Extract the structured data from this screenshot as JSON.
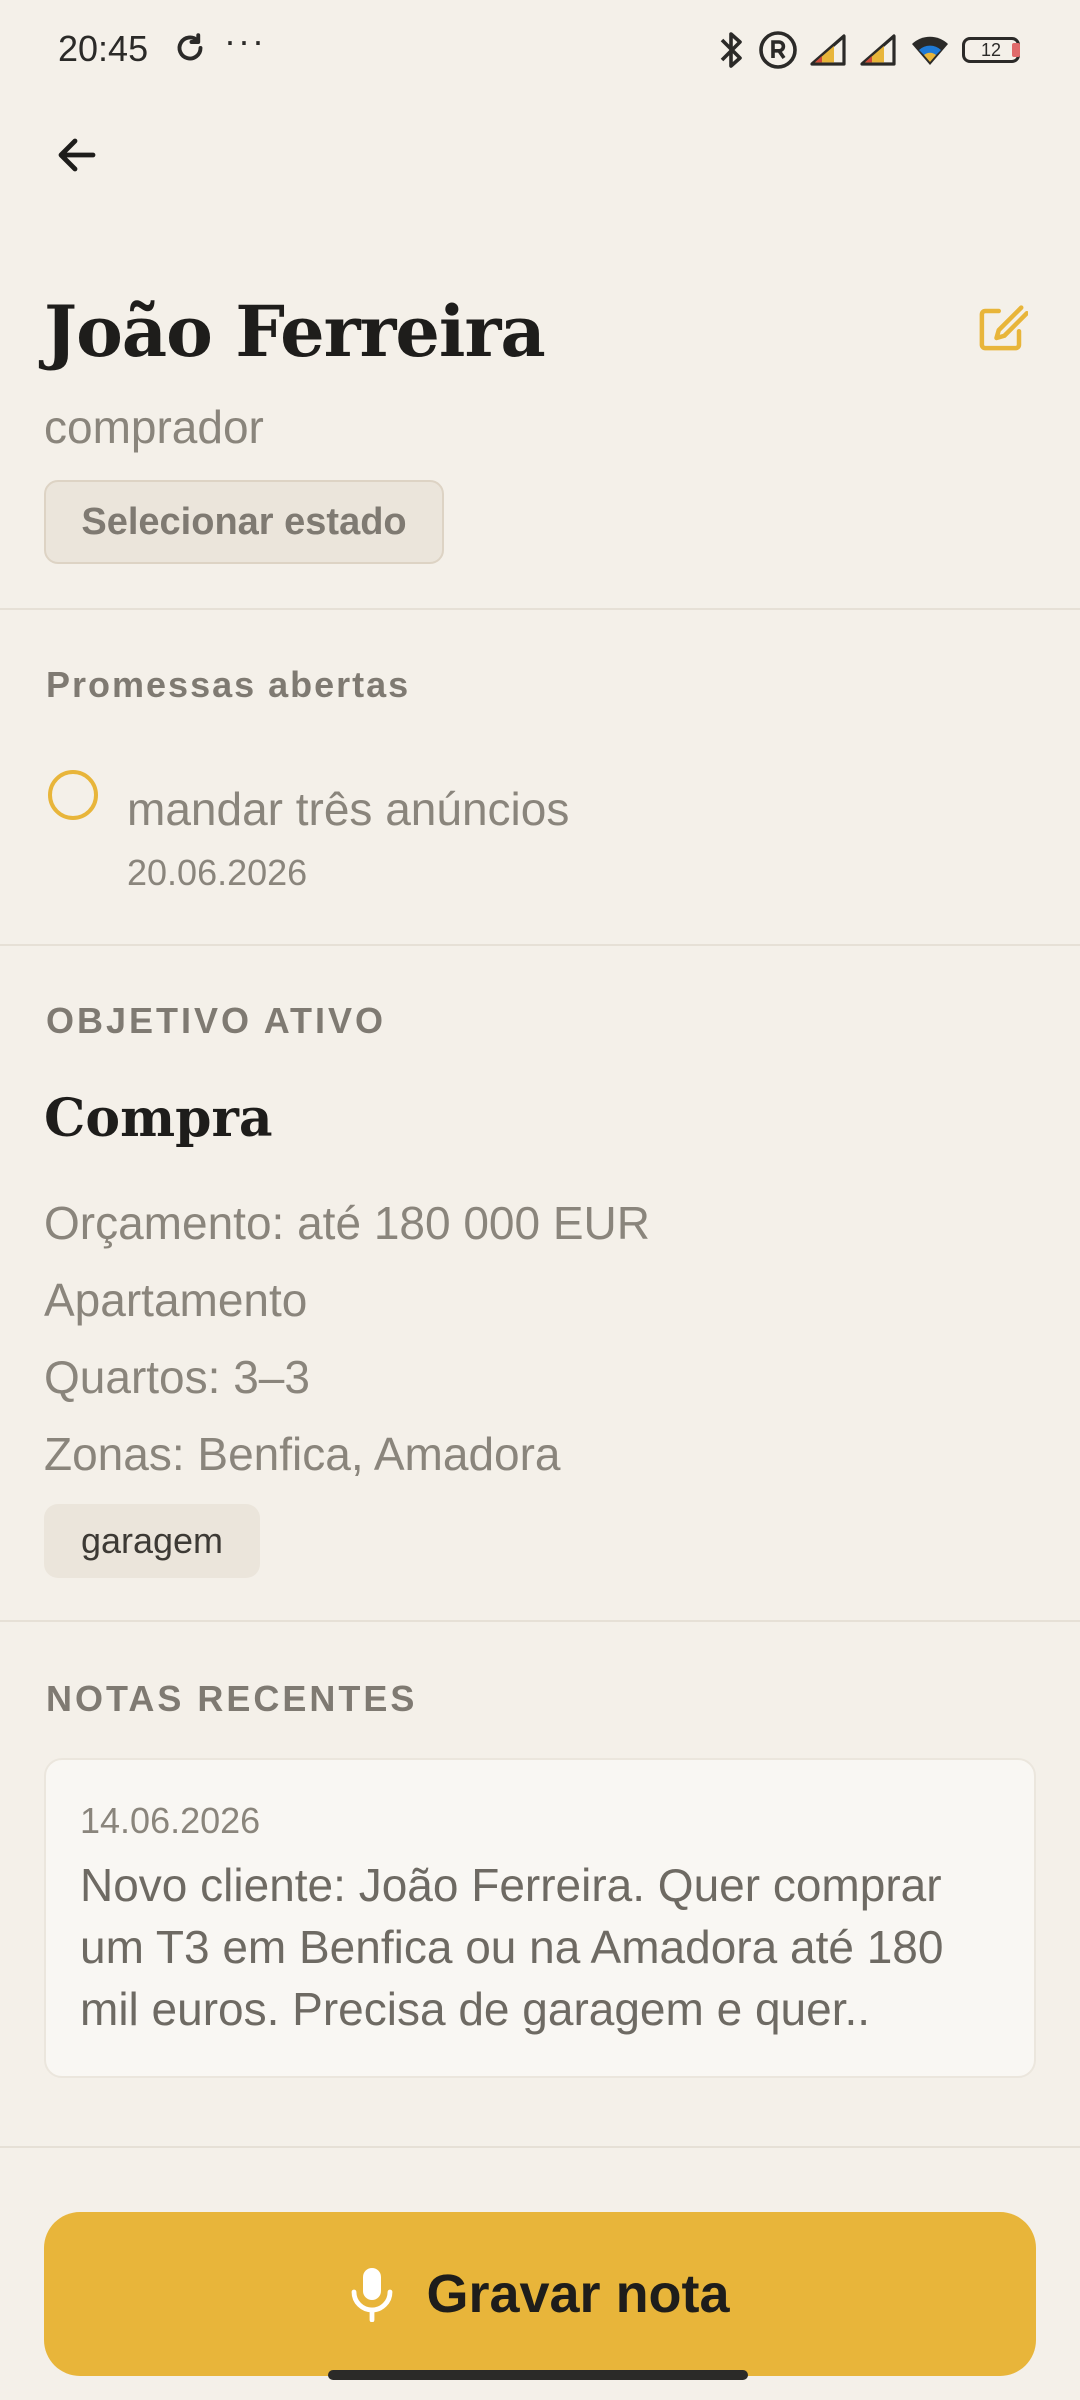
{
  "status_bar": {
    "time": "20:45",
    "dots": "···",
    "battery": "12"
  },
  "header": {
    "back_icon": "arrow-left-icon",
    "edit_icon": "edit-icon",
    "name": "João Ferreira",
    "role": "comprador",
    "state_button": "Selecionar estado"
  },
  "promises": {
    "label": "Promessas abertas",
    "items": [
      {
        "text": "mandar três anúncios",
        "date": "20.06.2026"
      }
    ]
  },
  "goal": {
    "label": "OBJETIVO ATIVO",
    "title": "Compra",
    "lines": [
      "Orçamento: até 180 000 EUR",
      "Apartamento",
      "Quartos: 3–3",
      "Zonas: Benfica, Amadora"
    ],
    "tags": [
      "garagem"
    ]
  },
  "notes": {
    "label": "NOTAS RECENTES",
    "items": [
      {
        "date": "14.06.2026",
        "text": "Novo cliente: João Ferreira. Quer comprar um T3 em Benfica ou na Amadora até 180 mil euros. Precisa de garagem e quer.."
      }
    ]
  },
  "record_button": {
    "label": "Gravar nota",
    "icon": "microphone-icon"
  },
  "colors": {
    "background": "#f4f0e9",
    "accent": "#e8b53a",
    "title": "#1e1d1b",
    "muted": "#8a857c"
  }
}
